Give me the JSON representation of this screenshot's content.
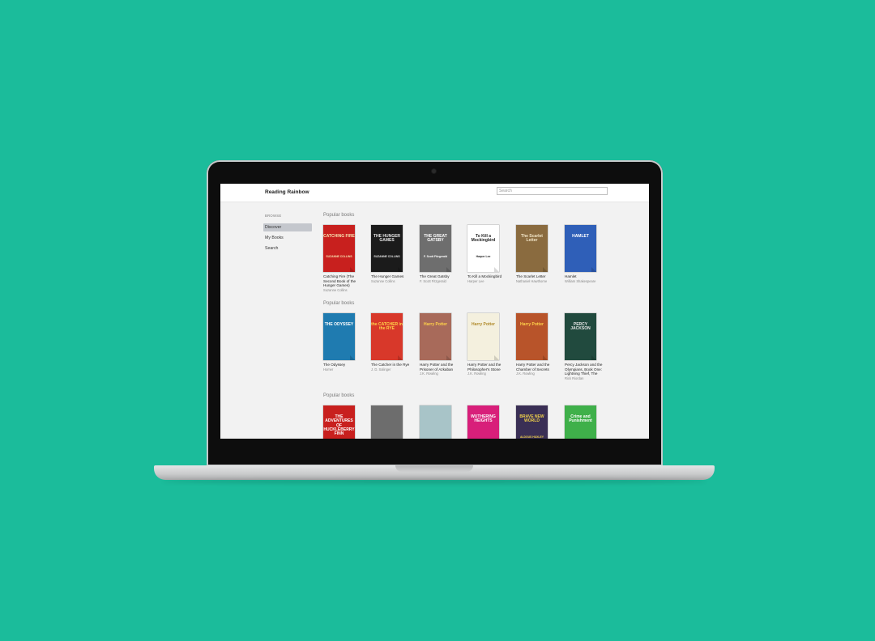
{
  "app": {
    "title": "Reading Rainbow",
    "search_placeholder": "Search"
  },
  "sidebar": {
    "heading": "BROWSE",
    "items": [
      {
        "label": "Discover",
        "active": true
      },
      {
        "label": "My Books",
        "active": false
      },
      {
        "label": "Search",
        "active": false
      }
    ]
  },
  "sections": [
    {
      "heading": "Popular books",
      "books": [
        {
          "title": "Catching Fire (The Second Book of the Hunger Games)",
          "author": "Suzanne Collins",
          "cover_text": "CATCHING FIRE",
          "cover_sub": "SUZANNE COLLINS",
          "cover_color": "#c8201e",
          "text_color": "#f7e3b0"
        },
        {
          "title": "The Hunger Games",
          "author": "Suzanne Collins",
          "cover_text": "THE HUNGER GAMES",
          "cover_sub": "SUZANNE COLLINS",
          "cover_color": "#1b1b1b",
          "text_color": "#e6e6e6"
        },
        {
          "title": "The Great Gatsby",
          "author": "F. Scott Fitzgerald",
          "cover_text": "THE GREAT GATSBY",
          "cover_sub": "F. Scott Fitzgerald",
          "cover_color": "#6e6e6e",
          "text_color": "#ffffff"
        },
        {
          "title": "To Kill a Mockingbird",
          "author": "Harper Lee",
          "cover_text": "To Kill a Mockingbird",
          "cover_sub": "Harper Lee",
          "cover_color": "#ffffff",
          "text_color": "#222222"
        },
        {
          "title": "The Scarlet Letter",
          "author": "Nathaniel Hawthorne",
          "cover_text": "The Scarlet Letter",
          "cover_sub": "",
          "cover_color": "#8a6b3f",
          "text_color": "#f2e6c8"
        },
        {
          "title": "Hamlet",
          "author": "William Shakespeare",
          "cover_text": "HAMLET",
          "cover_sub": "",
          "cover_color": "#2f5fb8",
          "text_color": "#ffffff"
        }
      ]
    },
    {
      "heading": "Popular books",
      "books": [
        {
          "title": "The Odyssey",
          "author": "Homer",
          "cover_text": "THE ODYSSEY",
          "cover_sub": "",
          "cover_color": "#1f7bb0",
          "text_color": "#ffffff"
        },
        {
          "title": "The Catcher in the Rye",
          "author": "J. D. Salinger",
          "cover_text": "the CATCHER in the RYE",
          "cover_sub": "",
          "cover_color": "#d8382a",
          "text_color": "#ffd34a"
        },
        {
          "title": "Harry Potter and the Prisoner of Azkaban",
          "author": "J.K. Rowling",
          "cover_text": "Harry Potter",
          "cover_sub": "",
          "cover_color": "#a86a5a",
          "text_color": "#ffd24a"
        },
        {
          "title": "Harry Potter and the Philosopher's Stone",
          "author": "J.K. Rowling",
          "cover_text": "Harry Potter",
          "cover_sub": "",
          "cover_color": "#f4f0de",
          "text_color": "#b08a2a"
        },
        {
          "title": "Harry Potter and the Chamber of Secrets",
          "author": "J.K. Rowling",
          "cover_text": "Harry Potter",
          "cover_sub": "",
          "cover_color": "#b8542a",
          "text_color": "#ffd24a"
        },
        {
          "title": "Percy Jackson and the Olympians, Book One: Lightning Thief, The",
          "author": "Rick Riordan",
          "cover_text": "PERCY JACKSON",
          "cover_sub": "",
          "cover_color": "#214a3e",
          "text_color": "#e8e8e8"
        }
      ]
    },
    {
      "heading": "Popular books",
      "books": [
        {
          "title": "",
          "author": "",
          "cover_text": "THE ADVENTURES OF HUCKLEBERRY FINN",
          "cover_sub": "",
          "cover_color": "#c8201e",
          "text_color": "#ffffff"
        },
        {
          "title": "",
          "author": "",
          "cover_text": "",
          "cover_sub": "",
          "cover_color": "#6d6d6d",
          "text_color": "#ffffff"
        },
        {
          "title": "",
          "author": "",
          "cover_text": "",
          "cover_sub": "",
          "cover_color": "#a8c4c8",
          "text_color": "#333333"
        },
        {
          "title": "",
          "author": "",
          "cover_text": "WUTHERING HEIGHTS",
          "cover_sub": "",
          "cover_color": "#d81f7a",
          "text_color": "#ffffff"
        },
        {
          "title": "",
          "author": "",
          "cover_text": "BRAVE NEW WORLD",
          "cover_sub": "ALDOUS HUXLEY",
          "cover_color": "#3a2f55",
          "text_color": "#f2d34a"
        },
        {
          "title": "",
          "author": "",
          "cover_text": "Crime and Punishment",
          "cover_sub": "",
          "cover_color": "#3fb04a",
          "text_color": "#ffffff"
        }
      ]
    }
  ],
  "colors": {
    "background": "#1bbc9b",
    "nav_active": "#c4c7cd"
  }
}
